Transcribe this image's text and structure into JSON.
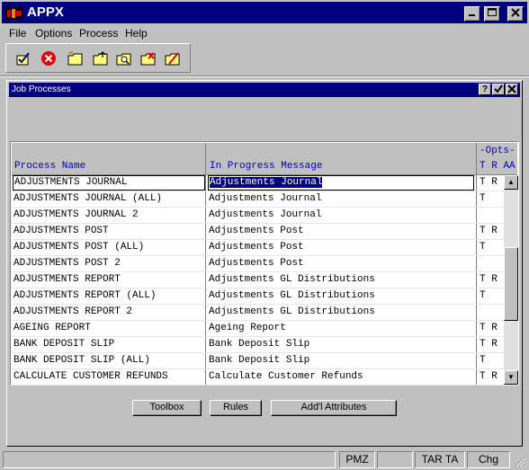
{
  "window": {
    "title": "APPX"
  },
  "menu": [
    {
      "label": "File"
    },
    {
      "label": "Options"
    },
    {
      "label": "Process"
    },
    {
      "label": "Help"
    }
  ],
  "toolbar": {
    "icons": [
      "ok-check-icon",
      "cancel-icon",
      "new-folder-icon",
      "open-folder-icon",
      "find-folder-icon",
      "delete-folder-icon",
      "clear-folder-icon"
    ]
  },
  "subwindow": {
    "title": "Job Processes"
  },
  "table": {
    "headers": {
      "process_name": "Process Name",
      "message": "In Progress Message",
      "opts": "-Opts-",
      "opts_cols": "T R AA"
    },
    "rows": [
      {
        "name": "ADJUSTMENTS JOURNAL",
        "message": "Adjustments Journal",
        "opts": "T R"
      },
      {
        "name": "ADJUSTMENTS JOURNAL (ALL)",
        "message": "Adjustments Journal",
        "opts": "T"
      },
      {
        "name": "ADJUSTMENTS JOURNAL 2",
        "message": "Adjustments Journal",
        "opts": ""
      },
      {
        "name": "ADJUSTMENTS POST",
        "message": "Adjustments Post",
        "opts": "T R"
      },
      {
        "name": "ADJUSTMENTS POST (ALL)",
        "message": "Adjustments Post",
        "opts": "T"
      },
      {
        "name": "ADJUSTMENTS POST 2",
        "message": "Adjustments Post",
        "opts": ""
      },
      {
        "name": "ADJUSTMENTS REPORT",
        "message": "Adjustments GL Distributions",
        "opts": "T R"
      },
      {
        "name": "ADJUSTMENTS REPORT (ALL)",
        "message": "Adjustments GL Distributions",
        "opts": "T"
      },
      {
        "name": "ADJUSTMENTS REPORT 2",
        "message": "Adjustments GL Distributions",
        "opts": ""
      },
      {
        "name": "AGEING REPORT",
        "message": "Ageing Report",
        "opts": "T R"
      },
      {
        "name": "BANK DEPOSIT SLIP",
        "message": "Bank Deposit Slip",
        "opts": "T R"
      },
      {
        "name": "BANK DEPOSIT SLIP (ALL)",
        "message": "Bank Deposit Slip",
        "opts": "T"
      },
      {
        "name": "CALCULATE CUSTOMER REFUNDS",
        "message": "Calculate Customer Refunds",
        "opts": "T R"
      }
    ]
  },
  "buttons": {
    "toolbox": "Toolbox",
    "rules": "Rules",
    "attributes": "Add'l Attributes"
  },
  "status": {
    "pane1": "",
    "pane2": "",
    "pane3": "PMZ",
    "pane4": "",
    "pane5": "TAR TA",
    "pane6": "Chg"
  }
}
